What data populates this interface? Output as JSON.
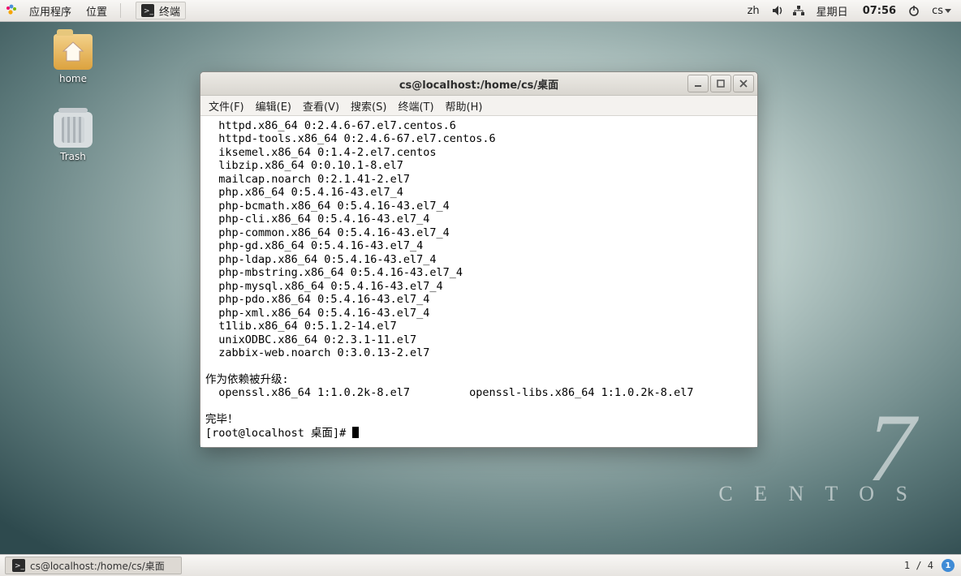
{
  "top": {
    "apps": "应用程序",
    "places": "位置",
    "running": "终端",
    "ime": "zh",
    "day": "星期日",
    "time": "07:56",
    "user": "cs"
  },
  "desktop": {
    "home": "home",
    "trash": "Trash"
  },
  "brand": {
    "seven": "7",
    "name": "C E N T O S"
  },
  "bottom": {
    "task": "cs@localhost:/home/cs/桌面",
    "workspace": "1 / 4",
    "notif": "1"
  },
  "win": {
    "title": "cs@localhost:/home/cs/桌面",
    "menu": [
      "文件(F)",
      "编辑(E)",
      "查看(V)",
      "搜索(S)",
      "终端(T)",
      "帮助(H)"
    ],
    "pkgs": [
      "httpd.x86_64 0:2.4.6-67.el7.centos.6",
      "httpd-tools.x86_64 0:2.4.6-67.el7.centos.6",
      "iksemel.x86_64 0:1.4-2.el7.centos",
      "libzip.x86_64 0:0.10.1-8.el7",
      "mailcap.noarch 0:2.1.41-2.el7",
      "php.x86_64 0:5.4.16-43.el7_4",
      "php-bcmath.x86_64 0:5.4.16-43.el7_4",
      "php-cli.x86_64 0:5.4.16-43.el7_4",
      "php-common.x86_64 0:5.4.16-43.el7_4",
      "php-gd.x86_64 0:5.4.16-43.el7_4",
      "php-ldap.x86_64 0:5.4.16-43.el7_4",
      "php-mbstring.x86_64 0:5.4.16-43.el7_4",
      "php-mysql.x86_64 0:5.4.16-43.el7_4",
      "php-pdo.x86_64 0:5.4.16-43.el7_4",
      "php-xml.x86_64 0:5.4.16-43.el7_4",
      "t1lib.x86_64 0:5.1.2-14.el7",
      "unixODBC.x86_64 0:2.3.1-11.el7",
      "zabbix-web.noarch 0:3.0.13-2.el7"
    ],
    "dep_hdr": "作为依赖被升级:",
    "dep1": "openssl.x86_64 1:1.0.2k-8.el7",
    "dep2": "openssl-libs.x86_64 1:1.0.2k-8.el7",
    "done": "完毕！",
    "prompt": "[root@localhost 桌面]# "
  }
}
